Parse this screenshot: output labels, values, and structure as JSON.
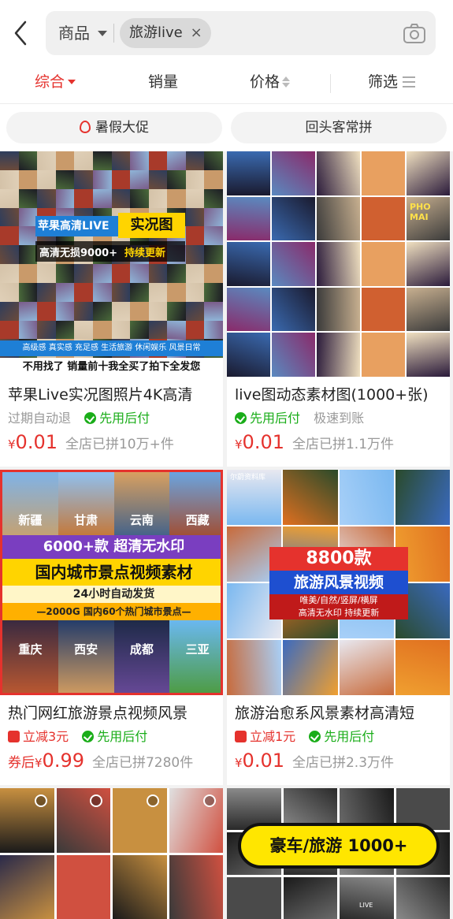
{
  "search": {
    "scope_label": "商品",
    "query_chip": "旅游live",
    "chip_remove": "×"
  },
  "sort": {
    "comprehensive": "综合",
    "sales": "销量",
    "price": "价格",
    "filter": "筛选"
  },
  "promos": {
    "left": "暑假大促",
    "right": "回头客常拼"
  },
  "products": [
    {
      "title": "苹果Live实况图照片4K高清",
      "tag1": "过期自动退",
      "tag2": "先用后付",
      "yen": "¥",
      "price": "0.01",
      "sold": "全店已拼10万+件",
      "banner_line1a": "苹果高清LIVE",
      "banner_line1b": "实况图",
      "banner_line2a": "高清无损9000+",
      "banner_line2b": "持续更新",
      "banner_tags": "高级感 真实感 充足感 生活旅游 休闲娱乐 风景日常",
      "banner_bottom": "不用找了 销量前十我全买了拍下全发您"
    },
    {
      "title": "live图动态素材图(1000+张)",
      "tag1": "先用后付",
      "tag2": "极速到账",
      "yen": "¥",
      "price": "0.01",
      "sold": "全店已拼1.1万件",
      "sign": "PHO MAI"
    },
    {
      "title": "热门网红旅游景点视频风景",
      "tag1": "立减3元",
      "tag2": "先用后付",
      "prefix": "券后",
      "yen": "¥",
      "price": "0.99",
      "sold": "全店已拼7280件",
      "cities_top": [
        "新疆",
        "甘肃",
        "云南",
        "西藏"
      ],
      "cities_bottom": [
        "重庆",
        "西安",
        "成都",
        "三亚"
      ],
      "b1": "6000+款  超清无水印",
      "b2": "国内城市景点视频素材",
      "b3": "24小时自动发货",
      "b4": "—2000G 国内60个热门城市景点—"
    },
    {
      "title": "旅游治愈系风景素材高清短",
      "tag1": "立减1元",
      "tag2": "先用后付",
      "yen": "¥",
      "price": "0.01",
      "sold": "全店已拼2.3万件",
      "corner": "尔蔚资料库",
      "b1": "8800款",
      "b2": "旅游风景视频",
      "b3": "唯美/自然/竖屏/横屏",
      "b4": "高清无水印  持续更新"
    },
    {
      "banner": "豪车/旅游 1000+",
      "live": "LIVE"
    }
  ],
  "colors": {
    "accent": "#e5322d",
    "green": "#1aad19",
    "gray_text": "#999999"
  }
}
